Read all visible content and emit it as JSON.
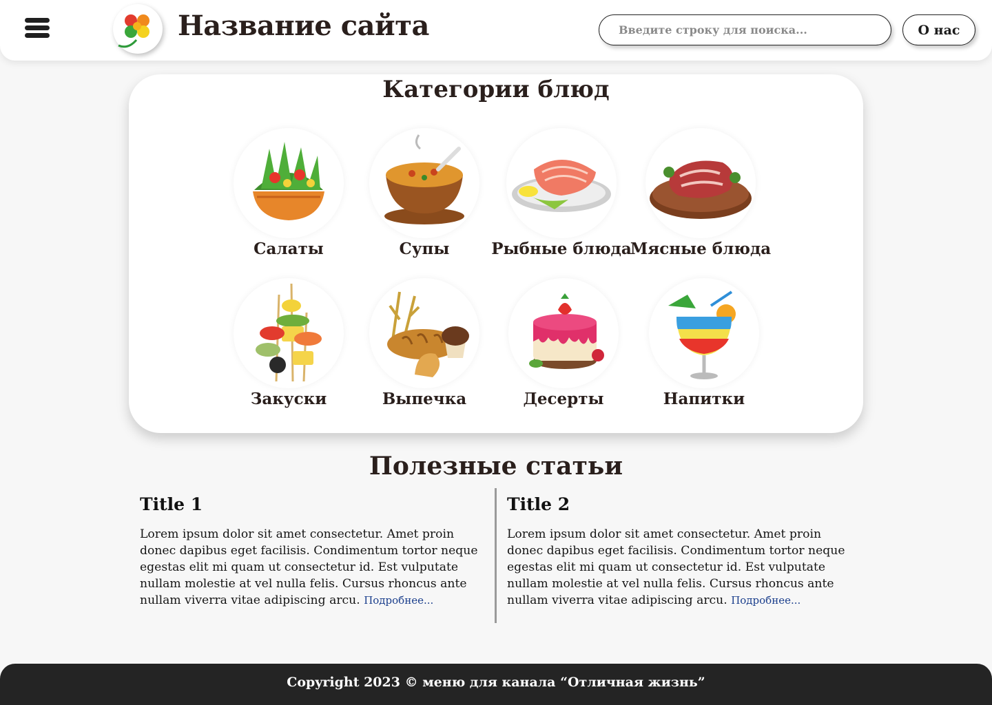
{
  "header": {
    "site_title": "Название сайта",
    "search_placeholder": "Введите строку для поиска...",
    "about_label": "О нас",
    "menu_icon": "hamburger-menu-icon",
    "logo_icon": "clover-logo-icon"
  },
  "categories": {
    "heading": "Категории блюд",
    "items": [
      {
        "label": "Салаты",
        "icon": "salad-bowl-icon"
      },
      {
        "label": "Супы",
        "icon": "soup-bowl-icon"
      },
      {
        "label": "Рыбные блюда",
        "icon": "salmon-steak-icon"
      },
      {
        "label": "Мясные блюда",
        "icon": "meat-steak-icon"
      },
      {
        "label": "Закуски",
        "icon": "canape-skewers-icon"
      },
      {
        "label": "Выпечка",
        "icon": "bread-pastry-icon"
      },
      {
        "label": "Десерты",
        "icon": "strawberry-cake-icon"
      },
      {
        "label": "Напитки",
        "icon": "cocktail-glass-icon"
      }
    ]
  },
  "articles": {
    "heading": "Полезные статьи",
    "items": [
      {
        "title": "Title 1",
        "body": "Lorem ipsum dolor sit amet consectetur. Amet proin donec dapibus eget facilisis. Condimentum tortor neque egestas elit mi quam ut consectetur id. Est vulputate nullam molestie at vel nulla felis. Cursus rhoncus ante nullam viverra vitae adipiscing arcu.",
        "more": "Подробнее..."
      },
      {
        "title": "Title 2",
        "body": "Lorem ipsum dolor sit amet consectetur. Amet proin donec dapibus eget facilisis. Condimentum tortor neque egestas elit mi quam ut consectetur id. Est vulputate nullam molestie at vel nulla felis. Cursus rhoncus ante nullam viverra vitae adipiscing arcu.",
        "more": "Подробнее..."
      }
    ]
  },
  "footer": {
    "text": "Copyright 2023 © меню для канала “Отличная жизнь”"
  },
  "colors": {
    "text_dark": "#2a1f1c",
    "footer_bg": "#242424",
    "link": "#1a3e8c",
    "divider": "#9a9a9a"
  }
}
